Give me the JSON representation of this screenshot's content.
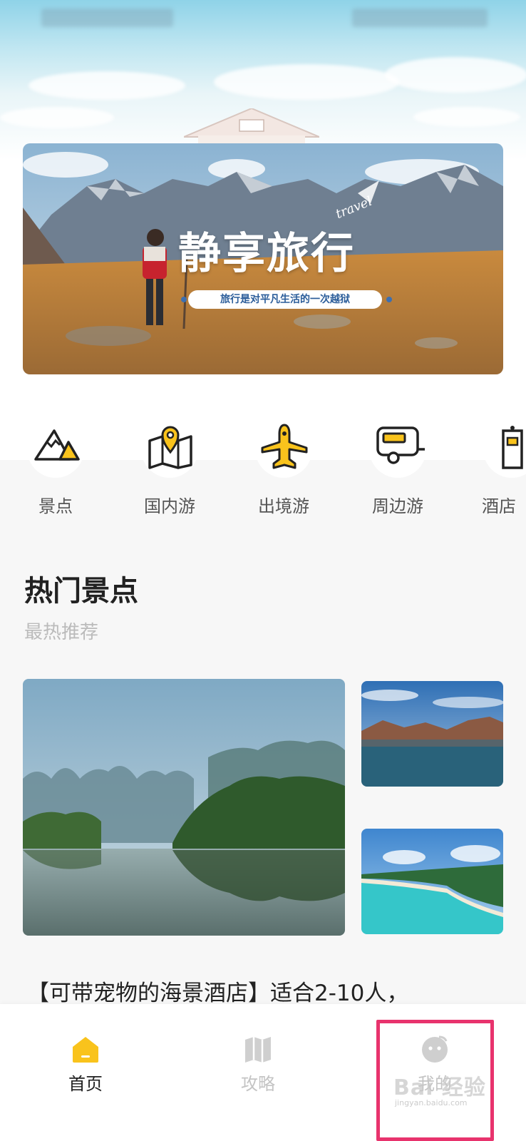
{
  "banner": {
    "title": "静享旅行",
    "subtitle": "旅行是对平凡生活的一次越狱",
    "script_text": "travel"
  },
  "categories": [
    {
      "label": "景点",
      "icon": "mountain-icon"
    },
    {
      "label": "国内游",
      "icon": "map-pin-icon"
    },
    {
      "label": "出境游",
      "icon": "airplane-icon"
    },
    {
      "label": "周边游",
      "icon": "camper-van-icon"
    },
    {
      "label": "酒店",
      "icon": "hotel-icon"
    }
  ],
  "hot_section": {
    "title": "热门景点",
    "subtitle": "最热推荐"
  },
  "featured_card": {
    "title": "【可带宠物的海景酒店】适合2-10人，"
  },
  "bottom_nav": [
    {
      "label": "首页",
      "icon": "home-icon",
      "active": true
    },
    {
      "label": "攻略",
      "icon": "map-icon",
      "active": false
    },
    {
      "label": "我的",
      "icon": "profile-face-icon",
      "active": false
    }
  ],
  "watermark": {
    "text": "Bai 经验",
    "url_text": "jingyan.baidu.com"
  },
  "colors": {
    "accent": "#f9c31c",
    "highlight_box": "#e8336d",
    "inactive": "#c4c4c4"
  }
}
